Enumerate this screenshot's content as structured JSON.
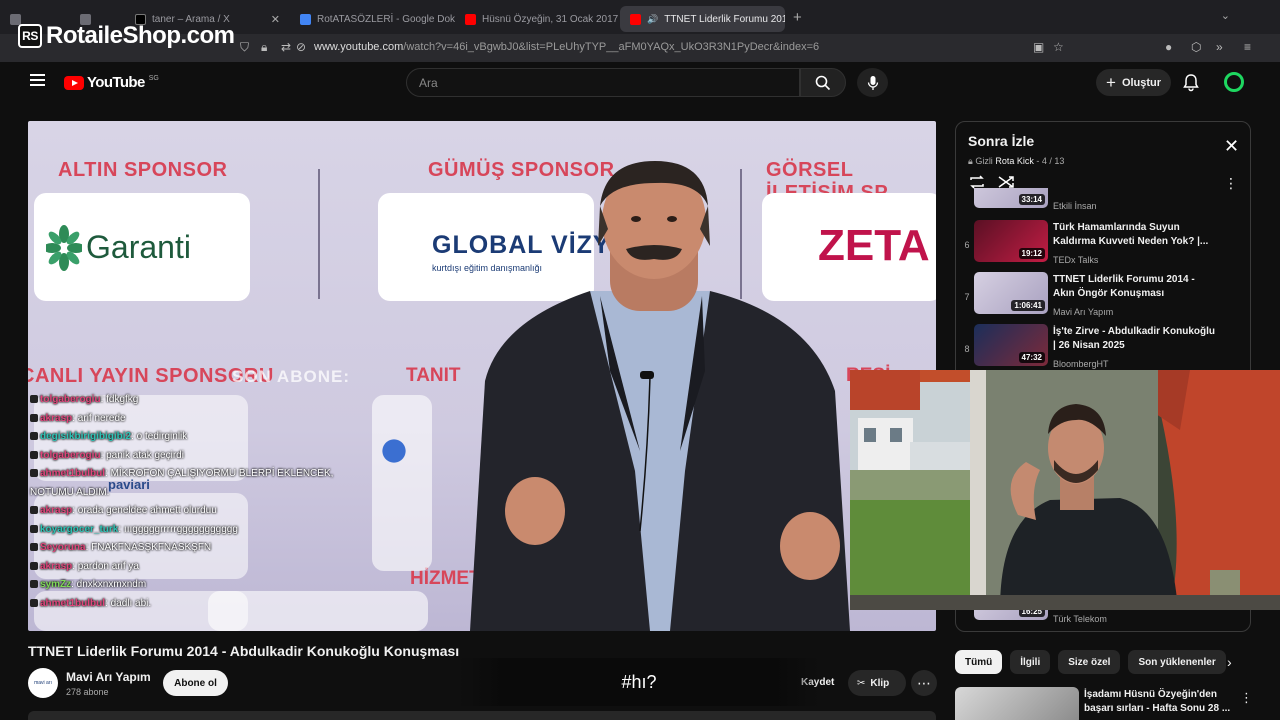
{
  "browser": {
    "tabs": [
      {
        "label": "",
        "icon": "tab-manager-icon",
        "color": "#6c6c74"
      },
      {
        "label": "",
        "icon": "tab-icon",
        "color": "#6c6c74"
      },
      {
        "label": "taner – Arama / X",
        "icon": "x-icon",
        "color": "#000000"
      },
      {
        "label": "RotATASÖZLERİ - Google Doküman",
        "icon": "docs-icon",
        "color": "#4285f4"
      },
      {
        "label": "Hüsnü Özyeğin, 31 Ocak 2017 P",
        "icon": "youtube-icon",
        "color": "#ff0000"
      },
      {
        "label": "TTNET Liderlik Forumu 2014",
        "icon": "youtube-icon",
        "color": "#ff0000",
        "active": true
      }
    ],
    "url_host": "www.youtube.com",
    "url_path": "/watch?v=46i_vBgwbJ0&list=PLeUhyTYP__aFM0YAQx_UkO3R3N1PyDecr&index=6"
  },
  "watermark": {
    "text": "RotaileShop.com",
    "badge": "RS"
  },
  "header": {
    "logo": "YouTube",
    "region": "SG",
    "search_placeholder": "Ara",
    "create_label": "Oluştur"
  },
  "video": {
    "sponsors": {
      "gold": "ALTIN SPONSOR",
      "silver": "GÜMÜŞ SPONSOR",
      "visual": "GÖRSEL İLETİŞİM SP",
      "live": "CANLI YAYIN SPONSORU",
      "tanit": "TANIT",
      "resi": "RESİ",
      "hizmet": "HİZMET S"
    },
    "logos": {
      "garanti": "Garanti",
      "global": "GLOBAL VİZYON",
      "global_sub": "kurtdışı eğitim danışmanlığı",
      "zeta": "ZETA",
      "paviari": "paviari"
    },
    "overlay": "SON ABONE:",
    "chat": [
      {
        "name": "tolgaberogiu",
        "color": "#e0457b",
        "msg": ": fdkgfkg"
      },
      {
        "name": "akrasp",
        "color": "#e0457b",
        "msg": ": arif nerede"
      },
      {
        "name": "degisikbirigibigibi2",
        "color": "#2ec4b6",
        "msg": ": o tedirginlik"
      },
      {
        "name": "tolgaberogiu",
        "color": "#e0457b",
        "msg": ": panik atak geçirdi"
      },
      {
        "name": "ahmet1bulbul",
        "color": "#e0457b",
        "msg": ": MİKROFON ÇALIŞIYORMU BLERPİ EKLENCEK, NOTUMU ALDIM."
      },
      {
        "name": "akrasp",
        "color": "#e0457b",
        "msg": ": orada geneldee ahmett olurduu"
      },
      {
        "name": "koyargocer_turk",
        "color": "#2ec4b6",
        "msg": ": ıııgggggrrrrrggggggggggg"
      },
      {
        "name": "Seyoruna",
        "color": "#e0457b",
        "msg": ": FNAKFNASŞKFNASKŞFN"
      },
      {
        "name": "akrasp",
        "color": "#e0457b",
        "msg": ": pardon arif ya"
      },
      {
        "name": "symZz",
        "color": "#7ed957",
        "msg": ": dnxkxnxmxndm"
      },
      {
        "name": "ahmet1bulbul",
        "color": "#e0457b",
        "msg": ": dadlı abi."
      }
    ],
    "title": "TTNET Liderlik Forumu 2014 - Abdulkadir Konukoğlu Konuşması",
    "channel": "Mavi Arı Yapım",
    "subscribers": "278 abone",
    "subscribe_label": "Abone ol",
    "channel_avatar_text": "mavi arı",
    "save_partial": "Kaydet",
    "clip_label": "Klip",
    "caption": "#hı?"
  },
  "playlist": {
    "title": "Sonra İzle",
    "privacy": "Gizli",
    "owner": "Rota Kick",
    "position": "4 / 13",
    "items": [
      {
        "num": "",
        "duration": "33:14",
        "title": "",
        "channel": "Etkili İnsan"
      },
      {
        "num": "6",
        "duration": "19:12",
        "title": "Türk Hamamlarında Suyun Kaldırma Kuvveti Neden Yok? |...",
        "channel": "TEDx Talks"
      },
      {
        "num": "7",
        "duration": "1:06:41",
        "title": "TTNET Liderlik Forumu 2014 - Akın Öngör Konuşması",
        "channel": "Mavi Arı Yapım"
      },
      {
        "num": "8",
        "duration": "47:32",
        "title": "İş'te Zirve - Abdulkadir Konukoğlu | 26 Nisan 2025",
        "channel": "BloombergHT"
      }
    ],
    "bottom_item": {
      "duration": "16:25",
      "channel": "Türk Telekom"
    }
  },
  "chips": [
    "Tümü",
    "İlgili",
    "Size özel",
    "Son yüklenenler"
  ],
  "recommendation": {
    "title": "İşadamı Hüsnü Özyeğin'den başarı sırları - Hafta Sonu 28 ..."
  }
}
